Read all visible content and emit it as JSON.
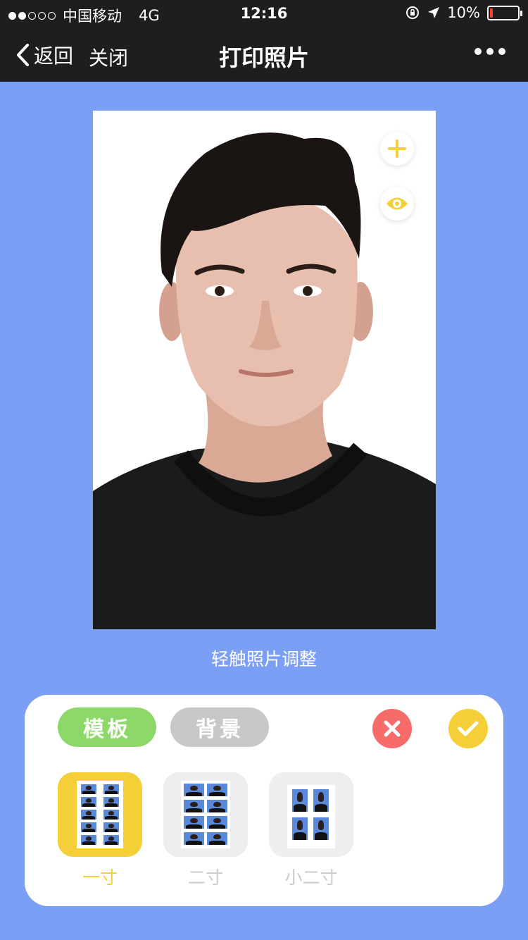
{
  "status_bar": {
    "carrier": "中国移动",
    "network": "4G",
    "time": "12:16",
    "battery_text": "10%",
    "battery_level": 0.1
  },
  "nav": {
    "back_label": "返回",
    "close_label": "关闭",
    "title": "打印照片"
  },
  "photo": {
    "hint": "轻触照片调整"
  },
  "panel": {
    "tabs": [
      {
        "label": "模板",
        "active": true
      },
      {
        "label": "背景",
        "active": false
      }
    ],
    "sizes": [
      {
        "label": "一寸",
        "selected": true
      },
      {
        "label": "二寸",
        "selected": false
      },
      {
        "label": "小二寸",
        "selected": false
      }
    ]
  },
  "colors": {
    "background": "#7b9ff4",
    "bar": "#1e1e21",
    "accent_yellow": "#f4cf37",
    "green": "#8ed86a",
    "grey": "#c8c8c8",
    "red": "#f76b6b"
  },
  "icons": [
    "signal-dots-icon",
    "lock-rotation-icon",
    "location-arrow-icon",
    "battery-icon",
    "back-chevron-icon",
    "more-dots-icon",
    "plus-icon",
    "eye-icon",
    "close-x-icon",
    "check-icon"
  ]
}
